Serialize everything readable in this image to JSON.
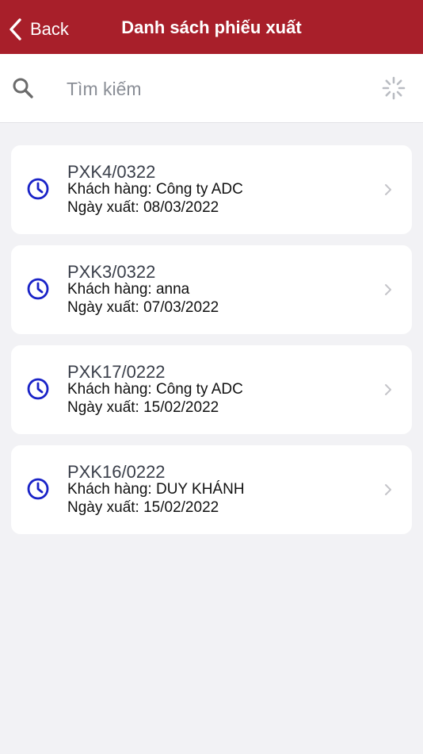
{
  "navbar": {
    "back_label": "Back",
    "title": "Danh sách phiếu xuất",
    "background": "#a81f2a"
  },
  "search": {
    "placeholder": "Tìm kiếm",
    "value": "",
    "icon": "search-icon",
    "loading_icon": "spinner-icon"
  },
  "items": [
    {
      "code": "PXK4/0322",
      "customer": "Khách hàng: Công ty ADC",
      "date": "Ngày xuất: 08/03/2022"
    },
    {
      "code": "PXK3/0322",
      "customer": "Khách hàng: anna",
      "date": "Ngày xuất: 07/03/2022"
    },
    {
      "code": "PXK17/0222",
      "customer": "Khách hàng: Công ty ADC",
      "date": "Ngày xuất: 15/02/2022"
    },
    {
      "code": "PXK16/0222",
      "customer": "Khách hàng: DUY KHÁNH",
      "date": "Ngày xuất: 15/02/2022"
    }
  ],
  "colors": {
    "accent": "#a81f2a",
    "status_icon": "#1a23c7",
    "background": "#f2f2f5"
  }
}
